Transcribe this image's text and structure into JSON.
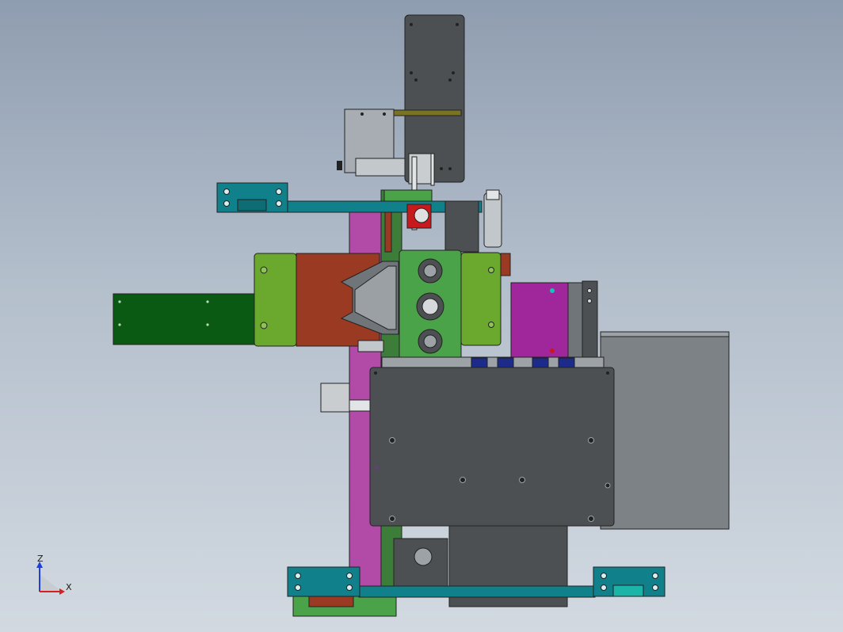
{
  "view": {
    "type": "cad-assembly-front-view",
    "background_top": "#8f9db0",
    "background_bottom": "#d2d9e1"
  },
  "triad": {
    "z_label": "Z",
    "x_label": "X",
    "z_color": "#1f3fd6",
    "x_color": "#d61f1f"
  },
  "palette": {
    "dark_plate": "#4c5052",
    "light_gray": "#a7adb2",
    "mid_gray": "#6f7579",
    "teal": "#10808a",
    "light_green": "#6ba82e",
    "green": "#4aa348",
    "dark_green": "#0b5a14",
    "rust": "#9b3a22",
    "magenta": "#a0269c",
    "violet_pink": "#b24ba8",
    "olive": "#7a7326",
    "navy": "#1c2a8a",
    "red": "#c8191d"
  }
}
